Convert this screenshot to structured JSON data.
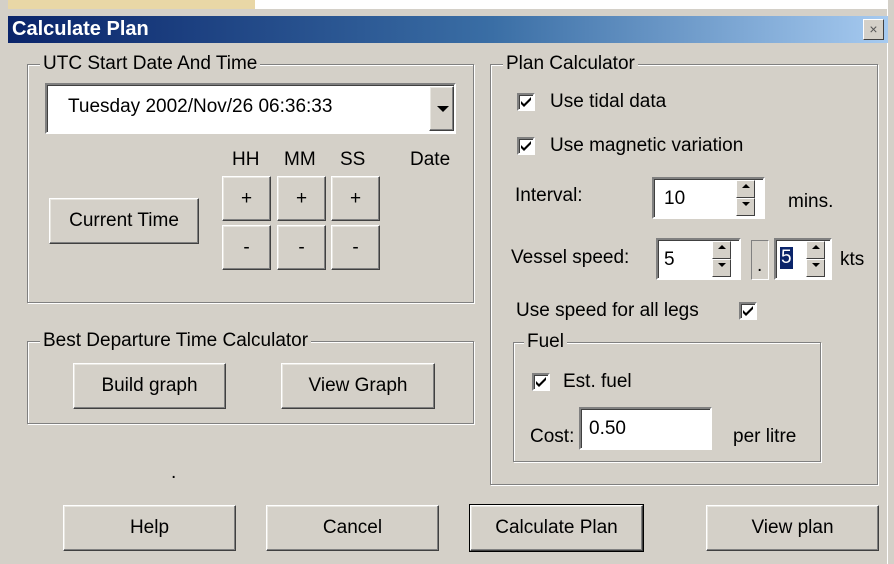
{
  "window": {
    "title": "Calculate Plan",
    "close_glyph": "×"
  },
  "utc_group": {
    "legend": "UTC Start Date And Time",
    "datetime_value": "Tuesday   2002/Nov/26 06:36:33",
    "current_time_button": "Current Time",
    "headers": {
      "hh": "HH",
      "mm": "MM",
      "ss": "SS",
      "date": "Date"
    },
    "plus": "+",
    "minus": "-"
  },
  "best_departure": {
    "legend": "Best Departure Time Calculator",
    "build_graph": "Build graph",
    "view_graph": "View Graph"
  },
  "stray_dot": ".",
  "plan_calculator": {
    "legend": "Plan Calculator",
    "use_tidal_data": {
      "label": "Use tidal data",
      "checked": true
    },
    "use_magnetic_variation": {
      "label": "Use magnetic variation",
      "checked": true
    },
    "interval": {
      "label": "Interval:",
      "value": "10",
      "unit": "mins."
    },
    "vessel_speed": {
      "label": "Vessel speed:",
      "whole": "5",
      "separator": ".",
      "fraction": "5",
      "unit": "kts"
    },
    "use_speed_all_legs": {
      "label": "Use speed for all legs",
      "checked": true
    },
    "fuel": {
      "legend": "Fuel",
      "est_fuel": {
        "label": "Est. fuel",
        "checked": true
      },
      "cost_label": "Cost:",
      "cost_value": "0.50",
      "cost_unit": "per litre"
    }
  },
  "footer": {
    "help": "Help",
    "cancel": "Cancel",
    "calculate_plan": "Calculate Plan",
    "view_plan": "View plan"
  }
}
